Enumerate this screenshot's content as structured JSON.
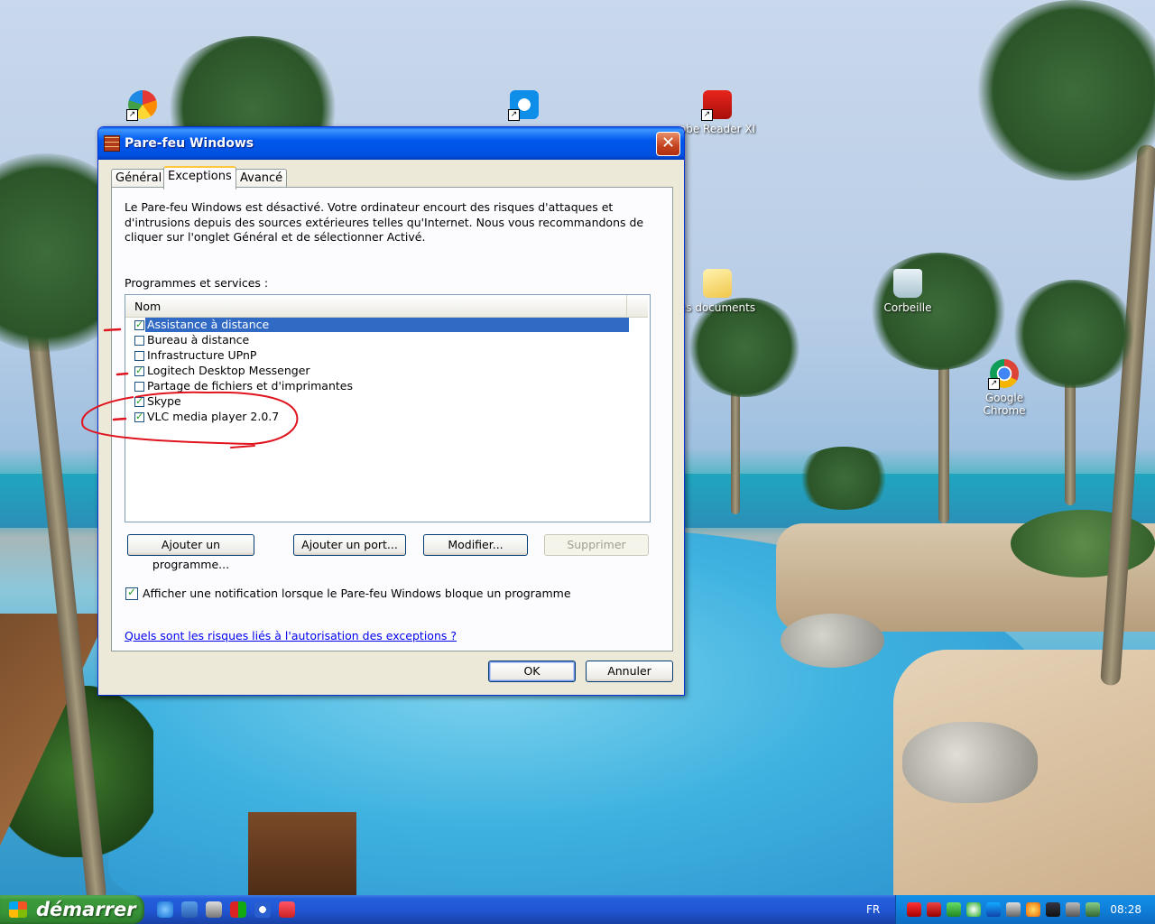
{
  "desktop": {
    "icons": [
      {
        "name": "picasa",
        "label": ""
      },
      {
        "name": "teamviewer",
        "label": ""
      },
      {
        "name": "adobe-reader",
        "label": "obe Reader XI"
      },
      {
        "name": "documents",
        "label": "es documents"
      },
      {
        "name": "recycle-bin",
        "label": "Corbeille"
      },
      {
        "name": "chrome",
        "label": "Google Chrome"
      }
    ]
  },
  "dialog": {
    "title": "Pare-feu Windows",
    "close_symbol": "✕",
    "tabs": [
      {
        "label": "Général",
        "active": false
      },
      {
        "label": "Exceptions",
        "active": true
      },
      {
        "label": "Avancé",
        "active": false
      }
    ],
    "warning": "Le Pare-feu Windows est désactivé. Votre ordinateur encourt des risques d'attaques et d'intrusions depuis des sources extérieures telles qu'Internet. Nous vous recommandons de cliquer sur l'onglet Général et de sélectionner Activé.",
    "programs_label": "Programmes et services :",
    "column_header": "Nom",
    "programs": [
      {
        "label": "Assistance à distance",
        "checked": true,
        "selected": true
      },
      {
        "label": "Bureau à distance",
        "checked": false,
        "selected": false
      },
      {
        "label": "Infrastructure UPnP",
        "checked": false,
        "selected": false
      },
      {
        "label": "Logitech Desktop Messenger",
        "checked": true,
        "selected": false
      },
      {
        "label": "Partage de fichiers et d'imprimantes",
        "checked": false,
        "selected": false
      },
      {
        "label": "Skype",
        "checked": true,
        "selected": false
      },
      {
        "label": "VLC media player 2.0.7",
        "checked": true,
        "selected": false
      }
    ],
    "buttons": {
      "add_program": "Ajouter un programme...",
      "add_port": "Ajouter un port...",
      "modify": "Modifier...",
      "delete": "Supprimer"
    },
    "notification_label": "Afficher une notification lorsque le Pare-feu Windows bloque un programme",
    "notification_checked": true,
    "risk_link": "Quels sont les risques liés à l'autorisation des exceptions ?",
    "ok": "OK",
    "cancel": "Annuler"
  },
  "taskbar": {
    "start_label": "démarrer",
    "language": "FR",
    "clock": "08:28"
  },
  "colors": {
    "titlebar": "#0058ee",
    "selection": "#316ac5",
    "annotation": "#e0141e",
    "taskbar": "#245edb",
    "start": "#379437"
  }
}
